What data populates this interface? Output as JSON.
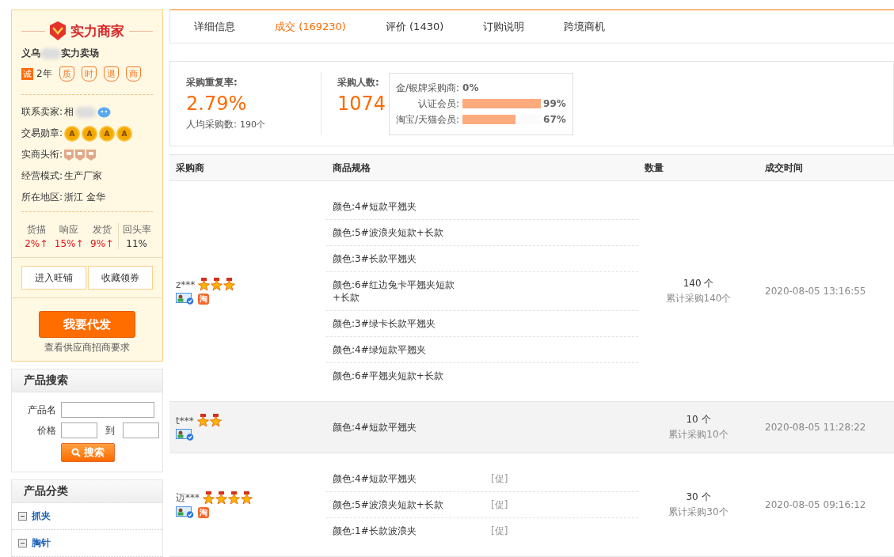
{
  "shop": {
    "badge_title": "实力商家",
    "name_start": "义乌",
    "name_end": "实力卖场",
    "cheng": "诚",
    "years": "2年",
    "service_icons": [
      "质",
      "时",
      "退",
      "商"
    ],
    "info": [
      {
        "kind": "contact",
        "label": "联系卖家:",
        "value": "相"
      },
      {
        "kind": "medals",
        "label": "交易勋章:",
        "medals": [
          "A",
          "A",
          "A",
          "A"
        ]
      },
      {
        "kind": "titles",
        "label": "实商头衔:"
      },
      {
        "kind": "text",
        "label": "经营模式:",
        "value": "生产厂家"
      },
      {
        "kind": "text",
        "label": "所在地区:",
        "value": "浙江 金华"
      }
    ],
    "metrics": [
      {
        "label": "货描",
        "value": "2%↑",
        "up": true
      },
      {
        "label": "响应",
        "value": "15%↑",
        "up": true
      },
      {
        "label": "发货",
        "value": "9%↑",
        "up": true
      },
      {
        "label": "回头率",
        "value": "11%",
        "up": false
      }
    ],
    "buttons": [
      "进入旺铺",
      "收藏领券"
    ],
    "primary_button": "我要代发",
    "link": "查看供应商招商要求"
  },
  "product_search": {
    "title": "产品搜索",
    "name_label": "产品名",
    "price_label": "价格",
    "to_label": "到",
    "button": "搜索"
  },
  "categories": {
    "title": "产品分类",
    "items": [
      {
        "label": "抓夹",
        "expanded": true
      },
      {
        "label": "胸针",
        "expanded": true
      }
    ]
  },
  "tabs": [
    {
      "label": "详细信息",
      "selected": false
    },
    {
      "label": "成交 (169230)",
      "selected": true
    },
    {
      "label": "评价 (1430)",
      "selected": false
    },
    {
      "label": "订购说明",
      "selected": false
    },
    {
      "label": "跨境商机",
      "selected": false
    }
  ],
  "stats": {
    "repeat_label": "采购重复率:",
    "repeat_value": "2.79%",
    "avg_label": "人均采购数:",
    "avg_value": "190个",
    "buyers_label": "采购人数:",
    "buyers_value": "1074",
    "breakdown": [
      {
        "label": "金/银牌采购商:",
        "value": "0%"
      },
      {
        "label": "认证会员:",
        "value": "99%",
        "level": 0.99
      },
      {
        "label": "淘宝/天猫会员:",
        "value": "67%",
        "level": 0.67
      }
    ]
  },
  "table": {
    "columns": [
      "采购商",
      "商品规格",
      "数量",
      "成交时间"
    ],
    "rows": [
      {
        "buyer": "z***",
        "stars": 3,
        "badge": "淘",
        "highlighted": false,
        "specs": [
          {
            "text": "颜色:4#短款平翘夹"
          },
          {
            "text": "颜色:5#波浪夹短款+长款"
          },
          {
            "text": "颜色:3#长款平翘夹"
          },
          {
            "text": "颜色:6#红边兔卡平翘夹短款+长款"
          },
          {
            "text": "颜色:3#绿卡长款平翘夹"
          },
          {
            "text": "颜色:4#绿短款平翘夹"
          },
          {
            "text": "颜色:6#平翘夹短款+长款"
          }
        ],
        "quantity": "140 个",
        "total": "累计采购140个",
        "time": "2020-08-05 13:16:55"
      },
      {
        "buyer": "t***",
        "stars": 2,
        "highlighted": true,
        "specs": [
          {
            "text": "颜色:4#短款平翘夹"
          }
        ],
        "quantity": "10 个",
        "total": "累计采购10个",
        "time": "2020-08-05 11:28:22"
      },
      {
        "buyer": "迈***",
        "stars": 4,
        "badge": "淘",
        "highlighted": false,
        "specs": [
          {
            "text": "颜色:4#短款平翘夹",
            "promo": "[促]"
          },
          {
            "text": "颜色:5#波浪夹短款+长款",
            "promo": "[促]"
          },
          {
            "text": "颜色:1#长款波浪夹",
            "promo": "[促]"
          }
        ],
        "quantity": "30 个",
        "total": "累计采购30个",
        "time": "2020-08-05 09:16:12"
      }
    ]
  }
}
